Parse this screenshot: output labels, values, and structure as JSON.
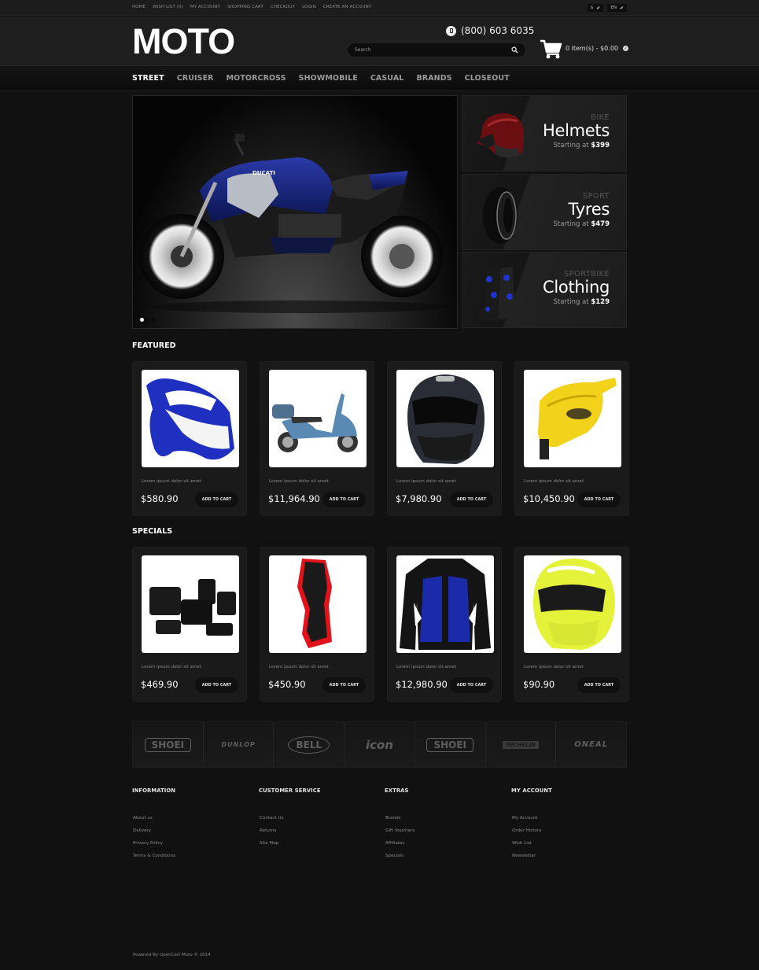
{
  "topbar": {
    "links": [
      "HOME",
      "WISH LIST (0)",
      "MY ACCOUNT",
      "SHOPPING CART",
      "CHECKOUT",
      "LOGIN",
      "CREATE AN ACCOUNT"
    ],
    "currency": "$",
    "language": "EN"
  },
  "header": {
    "logo": "MOTO",
    "phone": "(800) 603 6035",
    "search_placeholder": "Search",
    "search_value": "",
    "cart_summary": "0 item(s) - $0.00"
  },
  "nav": {
    "items": [
      "STREET",
      "CRUISER",
      "MOTORCROSS",
      "SHOWMOBILE",
      "CASUAL",
      "BRANDS",
      "CLOSEOUT"
    ],
    "active": "STREET"
  },
  "slider": {
    "image": "blue Ducati Diavel motorcycle",
    "slide_count": 3,
    "active_slide": 1,
    "brand_text": "DUCATI"
  },
  "banners": [
    {
      "kicker": "BIKE",
      "title": "Helmets",
      "starting_label": "Starting at",
      "price": "$399",
      "image": "red helmet"
    },
    {
      "kicker": "SPORT",
      "title": "Tyres",
      "starting_label": "Starting at",
      "price": "$479",
      "image": "tyre"
    },
    {
      "kicker": "SPORTBIKE",
      "title": "Clothing",
      "starting_label": "Starting at",
      "price": "$129",
      "image": "boots"
    }
  ],
  "featured": {
    "title": "FEATURED",
    "products": [
      {
        "desc": "Lorem ipsum dolor sit amet",
        "price": "$580.90",
        "button": "ADD TO CART",
        "image": "blue fairing plastics"
      },
      {
        "desc": "Lorem ipsum dolor sit amet",
        "price": "$11,964.90",
        "button": "ADD TO CART",
        "image": "blue scooter"
      },
      {
        "desc": "Lorem ipsum dolor sit amet",
        "price": "$7,980.90",
        "button": "ADD TO CART",
        "image": "black modular helmet"
      },
      {
        "desc": "Lorem ipsum dolor sit amet",
        "price": "$10,450.90",
        "button": "ADD TO CART",
        "image": "yellow hand guard"
      }
    ]
  },
  "specials": {
    "title": "SPECIALS",
    "products": [
      {
        "desc": "Lorem ipsum dolor sit amet",
        "price": "$469.90",
        "button": "ADD TO CART",
        "image": "leather saddlebags"
      },
      {
        "desc": "Lorem ipsum dolor sit amet",
        "price": "$450.90",
        "button": "ADD TO CART",
        "image": "knee guard"
      },
      {
        "desc": "Lorem ipsum dolor sit amet",
        "price": "$12,980.90",
        "button": "ADD TO CART",
        "image": "blue racing jacket"
      },
      {
        "desc": "Lorem ipsum dolor sit amet",
        "price": "$90.90",
        "button": "ADD TO CART",
        "image": "yellow helmet"
      }
    ]
  },
  "brands": [
    "SHOEI",
    "DUNLOP",
    "BELL",
    "icon",
    "SHOEI",
    "MICHELIN",
    "ONEAL"
  ],
  "footer": {
    "columns": [
      {
        "title": "INFORMATION",
        "links": [
          "About us",
          "Delivery",
          "Privacy Policy",
          "Terms & Conditions"
        ]
      },
      {
        "title": "CUSTOMER SERVICE",
        "links": [
          "Contact Us",
          "Returns",
          "Site Map"
        ]
      },
      {
        "title": "EXTRAS",
        "links": [
          "Brands",
          "Gift Vouchers",
          "Affiliates",
          "Specials"
        ]
      },
      {
        "title": "MY ACCOUNT",
        "links": [
          "My Account",
          "Order History",
          "Wish List",
          "Newsletter"
        ]
      }
    ],
    "powered": "Powered By OpenCart Moto © 2014"
  },
  "colors": {
    "background": "#111111",
    "header": "#1e1e1e",
    "card": "#1a1a1a",
    "text_primary": "#ffffff",
    "text_muted": "#8a8a8a"
  }
}
